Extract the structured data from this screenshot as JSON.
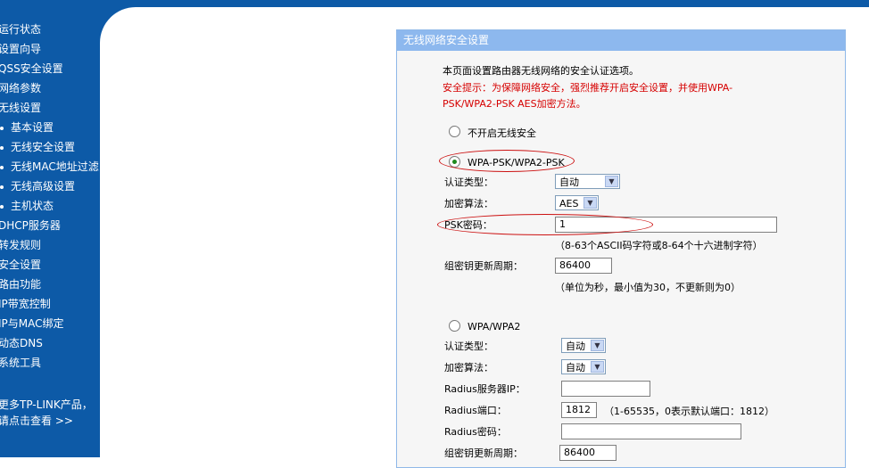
{
  "sidebar": {
    "items": [
      {
        "label": "运行状态",
        "sub": false
      },
      {
        "label": "设置向导",
        "sub": false
      },
      {
        "label": "QSS安全设置",
        "sub": false
      },
      {
        "label": "网络参数",
        "sub": false
      },
      {
        "label": "无线设置",
        "sub": false
      },
      {
        "label": "基本设置",
        "sub": true
      },
      {
        "label": "无线安全设置",
        "sub": true
      },
      {
        "label": "无线MAC地址过滤",
        "sub": true
      },
      {
        "label": "无线高级设置",
        "sub": true
      },
      {
        "label": "主机状态",
        "sub": true
      },
      {
        "label": "DHCP服务器",
        "sub": false
      },
      {
        "label": "转发规则",
        "sub": false
      },
      {
        "label": "安全设置",
        "sub": false
      },
      {
        "label": "路由功能",
        "sub": false
      },
      {
        "label": "IP带宽控制",
        "sub": false
      },
      {
        "label": "IP与MAC绑定",
        "sub": false
      },
      {
        "label": "动态DNS",
        "sub": false
      },
      {
        "label": "系统工具",
        "sub": false
      }
    ],
    "promo_line1": "更多TP-LINK产品，",
    "promo_line2": "请点击查看 >>"
  },
  "panel": {
    "title": "无线网络安全设置",
    "intro": "本页面设置路由器无线网络的安全认证选项。",
    "warning_line1": "安全提示：为保障网络安全，强烈推荐开启安全设置，并使用WPA-",
    "warning_line2": "PSK/WPA2-PSK AES加密方法。",
    "option_none": "不开启无线安全",
    "option_psk": "WPA-PSK/WPA2-PSK",
    "psk": {
      "auth_label": "认证类型：",
      "auth_value": "自动",
      "enc_label": "加密算法：",
      "enc_value": "AES",
      "key_label": "PSK密码：",
      "key_value": "1",
      "key_hint": "（8-63个ASCII码字符或8-64个十六进制字符）",
      "renew_label": "组密钥更新周期：",
      "renew_value": "86400",
      "renew_hint": "（单位为秒，最小值为30，不更新则为0）"
    },
    "option_wpa": "WPA/WPA2",
    "wpa": {
      "auth_label": "认证类型：",
      "auth_value": "自动",
      "enc_label": "加密算法：",
      "enc_value": "自动",
      "radius_ip_label": "Radius服务器IP：",
      "radius_ip_value": "",
      "radius_port_label": "Radius端口：",
      "radius_port_value": "1812",
      "radius_port_hint": "（1-65535，0表示默认端口：1812）",
      "radius_pwd_label": "Radius密码：",
      "radius_pwd_value": "",
      "renew_label": "组密钥更新周期：",
      "renew_value": "86400"
    }
  },
  "colors": {
    "sidebar": "#0d5aa7",
    "panel_header": "#8db8ee",
    "warning_text": "#d60000",
    "annotation": "#cc1111"
  }
}
